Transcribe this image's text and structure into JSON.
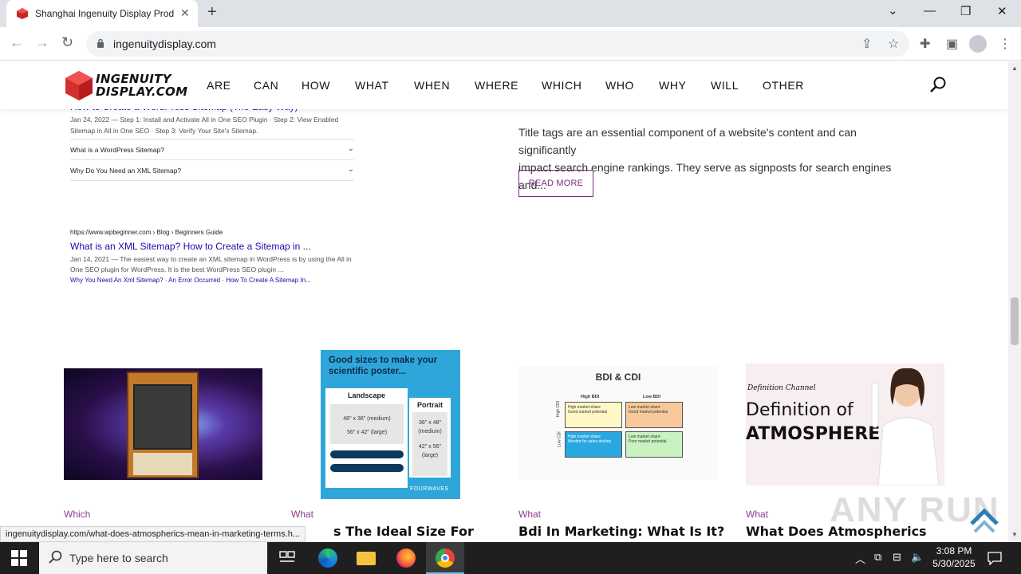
{
  "browser": {
    "tab_title": "Shanghai Ingenuity Display Prod",
    "tab_close": "✕",
    "new_tab": "+",
    "url": "ingenuitydisplay.com",
    "status_url": "ingenuitydisplay.com/what-does-atmospherics-mean-in-marketing-terms.h..."
  },
  "site": {
    "logo_line1": "INGENUITY",
    "logo_line2": "DISPLAY.COM",
    "menu": [
      "ARE",
      "CAN",
      "HOW",
      "WHAT",
      "WHEN",
      "WHERE",
      "WHICH",
      "WHO",
      "WHY",
      "WILL",
      "OTHER"
    ]
  },
  "serp": {
    "title_cut": "How to Create a WordPress Sitemap (The Easy Way)",
    "line1": "Jan 24, 2022 — Step 1: Install and Activate All in One SEO Plugin · Step 2: View Enabled",
    "line2": "Sitemap in All in One SEO · Step 3: Verify Your Site's Sitemap.",
    "faq1": "What is a WordPress Sitemap?",
    "faq2": "Why Do You Need an XML Sitemap?",
    "url": "https://www.wpbeginner.com › Blog › Beginners Guide",
    "link": "What is an XML Sitemap? How to Create a Sitemap in ...",
    "desc1": "Jan 14, 2021 — The easiest way to create an XML sitemap in WordPress is by using the All in",
    "desc2": "One SEO plugin for WordPress. It is the best WordPress SEO plugin ...",
    "sublinks": "Why You Need An Xml Sitemap? · An Error Occurred · How To Create A Sitemap In..."
  },
  "article": {
    "excerpt_line1": "Title tags are an essential component of a website's content and can significantly",
    "excerpt_line2": "impact search engine rankings. They serve as signposts for search engines and...",
    "read_more": "READ MORE"
  },
  "cards": [
    {
      "category": "Which",
      "title": ""
    },
    {
      "category": "What",
      "title": "s The Ideal Size For"
    },
    {
      "category": "What",
      "title": "Bdi In Marketing: What Is It?"
    },
    {
      "category": "What",
      "title": "What Does Atmospherics"
    }
  ],
  "poster_img": {
    "heading1": "Good sizes to make your",
    "heading2": "scientific poster...",
    "landscape": "Landscape",
    "portrait": "Portrait",
    "l1": "48\" x 36\" (medium)",
    "l2": "56\" x 42\" (large)",
    "p1": "36\" x 48\"",
    "p1b": "(medium)",
    "p2": "42\" x 56\"",
    "p2b": "(large)",
    "brand": "FOURWAVES"
  },
  "bdi_img": {
    "title": "BDI & CDI",
    "col1": "High BDI",
    "col2": "Low BDI",
    "row1": "High CDI",
    "row2": "Low CDI",
    "c11": "High market share\nGood market potential",
    "c12": "Low market share\nGood market potential",
    "c21": "High market share\nMonitor for sales decline",
    "c22": "Low market share\nPoor market potential"
  },
  "atmo_img": {
    "channel": "Definition Channel",
    "line1": "Definition of",
    "line2": "ATMOSPHERE"
  },
  "watermark": "ANY RUN",
  "taskbar": {
    "search_placeholder": "Type here to search",
    "time": "3:08 PM",
    "date": "5/30/2025"
  }
}
